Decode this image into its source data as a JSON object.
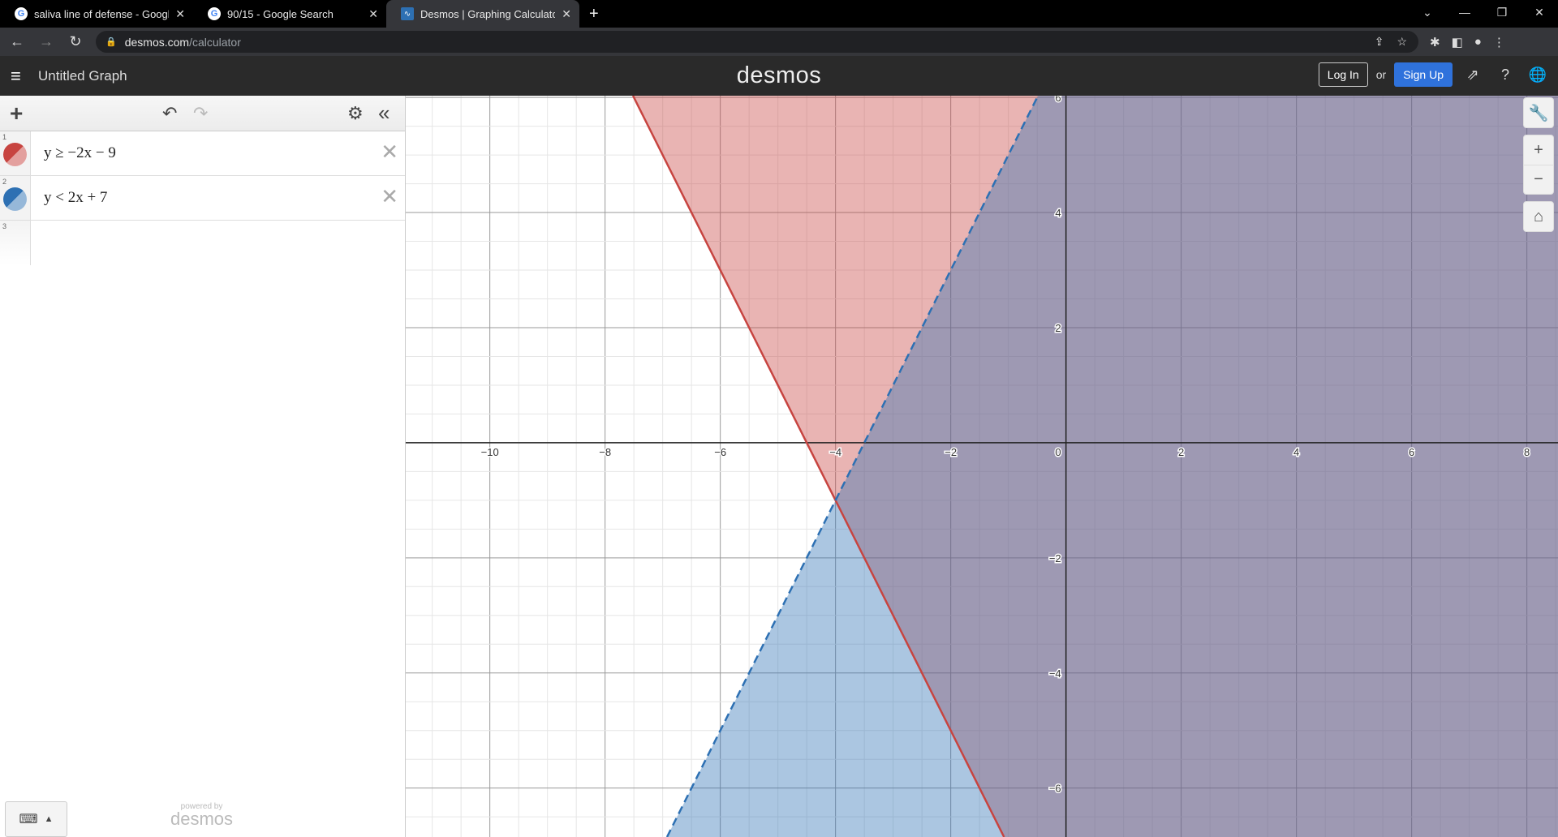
{
  "browser": {
    "tabs": [
      {
        "title": "saliva line of defense - Google Se",
        "icon": "google-icon",
        "active": false
      },
      {
        "title": "90/15 - Google Search",
        "icon": "google-icon",
        "active": false
      },
      {
        "title": "Desmos | Graphing Calculator",
        "icon": "desmos-icon",
        "active": true
      }
    ],
    "url_domain": "desmos.com",
    "url_path": "/calculator"
  },
  "header": {
    "title": "Untitled Graph",
    "logo": "desmos",
    "login": "Log In",
    "or": "or",
    "signup": "Sign Up"
  },
  "expressions": [
    {
      "num": "1",
      "latex": "y ≥ −2x − 9",
      "color": "#c74440",
      "slope": -2,
      "intercept": -9,
      "op": ">=",
      "dashed": false
    },
    {
      "num": "2",
      "latex": "y < 2x + 7",
      "color": "#2d70b3",
      "slope": 2,
      "intercept": 7,
      "op": "<",
      "dashed": true
    },
    {
      "num": "3",
      "latex": ""
    }
  ],
  "footer": {
    "powered": "powered by",
    "brand": "desmos"
  },
  "graph": {
    "xrange": [
      -11.46,
      8.54
    ],
    "yrange": [
      -6.85,
      6.03
    ],
    "major_step": 2,
    "minor_step": 0.5,
    "fill_opacity": 0.4
  }
}
